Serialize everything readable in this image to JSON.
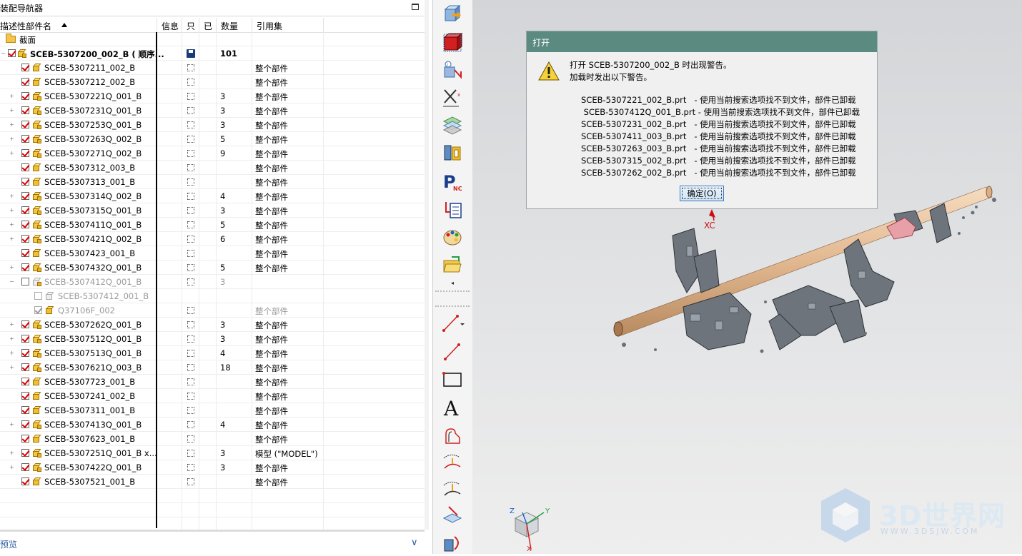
{
  "navigator": {
    "title": "装配导航器",
    "columns": {
      "name": "描述性部件名",
      "info": "信息",
      "readonly": "只",
      "modified": "已",
      "quantity": "数量",
      "refset": "引用集"
    },
    "rows": [
      {
        "name": "截面",
        "qty": "",
        "ref": "",
        "kind": "folder"
      },
      {
        "name": "SCEB-5307200_002_B ( 顺序...",
        "qty": "101",
        "ref": "",
        "kind": "root"
      },
      {
        "name": "SCEB-5307211_002_B",
        "qty": "",
        "ref": "整个部件",
        "kind": "part"
      },
      {
        "name": "SCEB-5307212_002_B",
        "qty": "",
        "ref": "整个部件",
        "kind": "part"
      },
      {
        "name": "SCEB-5307221Q_001_B",
        "qty": "3",
        "ref": "整个部件",
        "kind": "asm"
      },
      {
        "name": "SCEB-5307231Q_001_B",
        "qty": "3",
        "ref": "整个部件",
        "kind": "asm"
      },
      {
        "name": "SCEB-5307253Q_001_B",
        "qty": "3",
        "ref": "整个部件",
        "kind": "asm"
      },
      {
        "name": "SCEB-5307263Q_002_B",
        "qty": "5",
        "ref": "整个部件",
        "kind": "asm"
      },
      {
        "name": "SCEB-5307271Q_002_B",
        "qty": "9",
        "ref": "整个部件",
        "kind": "asm"
      },
      {
        "name": "SCEB-5307312_003_B",
        "qty": "",
        "ref": "整个部件",
        "kind": "part"
      },
      {
        "name": "SCEB-5307313_001_B",
        "qty": "",
        "ref": "整个部件",
        "kind": "part"
      },
      {
        "name": "SCEB-5307314Q_002_B",
        "qty": "4",
        "ref": "整个部件",
        "kind": "asm"
      },
      {
        "name": "SCEB-5307315Q_001_B",
        "qty": "3",
        "ref": "整个部件",
        "kind": "asm"
      },
      {
        "name": "SCEB-5307411Q_001_B",
        "qty": "5",
        "ref": "整个部件",
        "kind": "asm"
      },
      {
        "name": "SCEB-5307421Q_002_B",
        "qty": "6",
        "ref": "整个部件",
        "kind": "asm"
      },
      {
        "name": "SCEB-5307423_001_B",
        "qty": "",
        "ref": "整个部件",
        "kind": "part"
      },
      {
        "name": "SCEB-5307432Q_001_B",
        "qty": "5",
        "ref": "整个部件",
        "kind": "asm"
      },
      {
        "name": "SCEB-5307412Q_001_B",
        "qty": "3",
        "ref": "",
        "kind": "asm-grey"
      },
      {
        "name": "SCEB-5307412_001_B",
        "qty": "",
        "ref": "",
        "kind": "grey-child"
      },
      {
        "name": "Q37106F_002",
        "qty": "",
        "ref": "整个部件",
        "kind": "grey-child2"
      },
      {
        "name": "SCEB-5307262Q_001_B",
        "qty": "3",
        "ref": "整个部件",
        "kind": "asm"
      },
      {
        "name": "SCEB-5307512Q_001_B",
        "qty": "3",
        "ref": "整个部件",
        "kind": "asm"
      },
      {
        "name": "SCEB-5307513Q_001_B",
        "qty": "4",
        "ref": "整个部件",
        "kind": "asm"
      },
      {
        "name": "SCEB-5307621Q_003_B",
        "qty": "18",
        "ref": "整个部件",
        "kind": "asm"
      },
      {
        "name": "SCEB-5307723_001_B",
        "qty": "",
        "ref": "整个部件",
        "kind": "part"
      },
      {
        "name": "SCEB-5307241_002_B",
        "qty": "",
        "ref": "整个部件",
        "kind": "part"
      },
      {
        "name": "SCEB-5307311_001_B",
        "qty": "",
        "ref": "整个部件",
        "kind": "part"
      },
      {
        "name": "SCEB-5307413Q_001_B",
        "qty": "4",
        "ref": "整个部件",
        "kind": "asm"
      },
      {
        "name": "SCEB-5307623_001_B",
        "qty": "",
        "ref": "整个部件",
        "kind": "part"
      },
      {
        "name": "SCEB-5307251Q_001_B x...",
        "qty": "3",
        "ref": "模型 (\"MODEL\")",
        "kind": "asm"
      },
      {
        "name": "SCEB-5307422Q_001_B",
        "qty": "3",
        "ref": "整个部件",
        "kind": "asm"
      },
      {
        "name": "SCEB-5307521_001_B",
        "qty": "",
        "ref": "整个部件",
        "kind": "part"
      }
    ],
    "preview_label": "预览"
  },
  "dialog": {
    "title": "打开",
    "line1": "打开 SCEB-5307200_002_B 时出现警告。",
    "line2": "加载时发出以下警告。",
    "warnings": [
      "SCEB-5307221_002_B.prt   - 使用当前搜索选项找不到文件，部件已卸载",
      " SCEB-5307412Q_001_B.prt - 使用当前搜索选项找不到文件，部件已卸载",
      "SCEB-5307231_002_B.prt   - 使用当前搜索选项找不到文件，部件已卸载",
      "SCEB-5307411_003_B.prt   - 使用当前搜索选项找不到文件，部件已卸载",
      "SCEB-5307263_003_B.prt   - 使用当前搜索选项找不到文件，部件已卸载",
      "SCEB-5307315_002_B.prt   - 使用当前搜索选项找不到文件，部件已卸载",
      "SCEB-5307262_002_B.prt   - 使用当前搜索选项找不到文件，部件已卸载"
    ],
    "ok_label": "确定(O)"
  },
  "viewport": {
    "axis_xc": "XC",
    "triad": {
      "z": "Z",
      "y": "Y",
      "x": "X"
    },
    "watermark": "3D世界网",
    "watermark_url": "WWW.3DSJW.COM"
  },
  "colors": {
    "dialog_title_bar": "#5a8a80",
    "tube": "#e8c4a0",
    "accent_red": "#cc1010"
  }
}
